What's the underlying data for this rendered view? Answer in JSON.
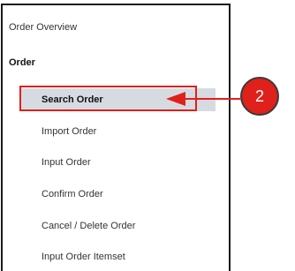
{
  "sidebar": {
    "overview_label": "Order Overview",
    "section_label": "Order",
    "items": [
      {
        "label": "Search Order"
      },
      {
        "label": "Import Order"
      },
      {
        "label": "Input Order"
      },
      {
        "label": "Confirm Order"
      },
      {
        "label": "Cancel / Delete Order"
      },
      {
        "label": "Input Order Itemset"
      }
    ],
    "active_index": 0
  },
  "annotation": {
    "callout_number": "2",
    "color": "#e0201b"
  },
  "colors": {
    "active_background": "#d6dbe2",
    "panel_border": "#1a1a1a"
  }
}
